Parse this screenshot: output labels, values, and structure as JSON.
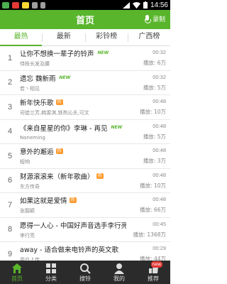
{
  "status": {
    "time": "14:56"
  },
  "header": {
    "title": "首页",
    "record_label": "录制"
  },
  "tabs": [
    {
      "label": "最热"
    },
    {
      "label": "最新"
    },
    {
      "label": "彩铃榜"
    },
    {
      "label": "广西榜"
    }
  ],
  "list": [
    {
      "num": "1",
      "title": "让你不想换一辈子的铃声",
      "tag": "NEW",
      "artist": "侍枝长发及腰",
      "duration": "00:32",
      "plays": "播放: 6万"
    },
    {
      "num": "2",
      "title": "遗忘 魏新雨",
      "tag": "NEW",
      "artist": "若丶相见",
      "duration": "00:32",
      "plays": "播放: 5万"
    },
    {
      "num": "3",
      "title": "新年快乐歌",
      "tag": "热",
      "artist": "司徒兰芳,韩雯淇,铁热沁夫,可文",
      "duration": "00:48",
      "plays": "播放: 10万"
    },
    {
      "num": "4",
      "title": "《来自星星的你》李琳 - 再见",
      "tag": "NEW",
      "artist": "Noneming",
      "duration": "00:48",
      "plays": "播放: 5万"
    },
    {
      "num": "5",
      "title": "意外的邂逅",
      "tag": "热",
      "artist": "程响",
      "duration": "00:48",
      "plays": "播放: 3万"
    },
    {
      "num": "6",
      "title": "财源滚滚来（新年歌曲）",
      "tag": "热",
      "artist": "东方传奇",
      "duration": "00:48",
      "plays": "播放: 10万"
    },
    {
      "num": "7",
      "title": "如果这就是爱情",
      "tag": "热",
      "artist": "张靓颖",
      "duration": "00:48",
      "plays": "播放: 66万"
    },
    {
      "num": "8",
      "title": "愿得一人心 - 中国好声音选手李行亮",
      "tag": "热",
      "artist": "李行亮",
      "duration": "00:45",
      "plays": "播放: 1368万"
    },
    {
      "num": "9",
      "title": "away - 适合做来电铃声的英文歌",
      "tag": "",
      "artist": "用户上传",
      "duration": "00:29",
      "plays": "播放: 44万"
    }
  ],
  "bottomnav": [
    {
      "label": "首页",
      "icon": "home-icon"
    },
    {
      "label": "分类",
      "icon": "grid-icon"
    },
    {
      "label": "搜铃",
      "icon": "search-icon"
    },
    {
      "label": "我的",
      "icon": "user-icon"
    },
    {
      "label": "推荐",
      "icon": "recommend-icon",
      "badge": "new"
    }
  ],
  "colors": {
    "accent": "#59b52c",
    "hot_tag": "#ff9a2e",
    "nav_bg": "#2b2b2b"
  }
}
